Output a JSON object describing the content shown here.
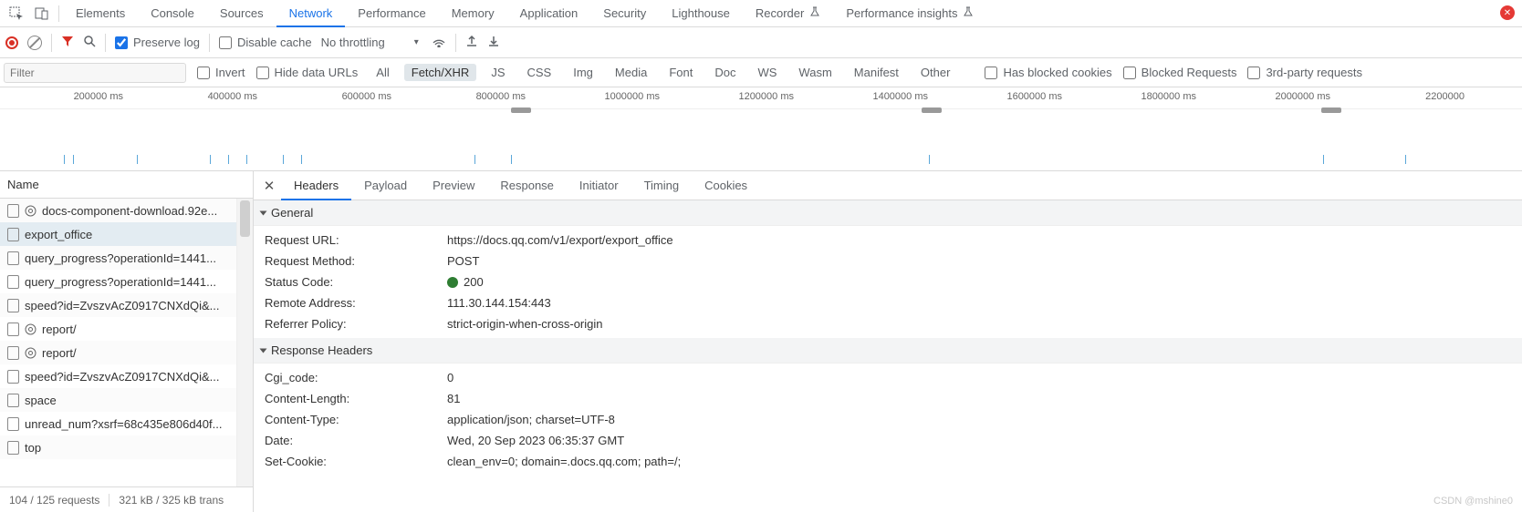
{
  "topTabs": [
    "Elements",
    "Console",
    "Sources",
    "Network",
    "Performance",
    "Memory",
    "Application",
    "Security",
    "Lighthouse",
    "Recorder",
    "Performance insights"
  ],
  "topActive": 3,
  "flaskTabs": [
    9,
    10
  ],
  "toolbar": {
    "preserveLog": "Preserve log",
    "disableCache": "Disable cache",
    "throttling": "No throttling"
  },
  "filter": {
    "placeholder": "Filter",
    "invert": "Invert",
    "hideData": "Hide data URLs",
    "types": [
      "All",
      "Fetch/XHR",
      "JS",
      "CSS",
      "Img",
      "Media",
      "Font",
      "Doc",
      "WS",
      "Wasm",
      "Manifest",
      "Other"
    ],
    "typeActive": 1,
    "hasBlocked": "Has blocked cookies",
    "blockedReq": "Blocked Requests",
    "thirdParty": "3rd-party requests"
  },
  "ticks": [
    "200000 ms",
    "400000 ms",
    "600000 ms",
    "800000 ms",
    "1000000 ms",
    "1200000 ms",
    "1400000 ms",
    "1600000 ms",
    "1800000 ms",
    "2000000 ms",
    "2200000"
  ],
  "nameHeader": "Name",
  "requests": [
    {
      "label": "docs-component-download.92e...",
      "type": "gear"
    },
    {
      "label": "export_office",
      "type": "doc",
      "selected": true
    },
    {
      "label": "query_progress?operationId=1441...",
      "type": "doc"
    },
    {
      "label": "query_progress?operationId=1441...",
      "type": "doc"
    },
    {
      "label": "speed?id=ZvszvAcZ0917CNXdQi&...",
      "type": "doc"
    },
    {
      "label": "report/",
      "type": "gear"
    },
    {
      "label": "report/",
      "type": "gear"
    },
    {
      "label": "speed?id=ZvszvAcZ0917CNXdQi&...",
      "type": "doc"
    },
    {
      "label": "space",
      "type": "doc"
    },
    {
      "label": "unread_num?xsrf=68c435e806d40f...",
      "type": "doc"
    },
    {
      "label": "top",
      "type": "doc"
    }
  ],
  "status": {
    "summary": "104 / 125 requests",
    "size": "321 kB / 325 kB trans"
  },
  "detailTabs": [
    "Headers",
    "Payload",
    "Preview",
    "Response",
    "Initiator",
    "Timing",
    "Cookies"
  ],
  "detailActive": 0,
  "sections": {
    "general": {
      "title": "General",
      "rows": [
        {
          "k": "Request URL:",
          "v": "https://docs.qq.com/v1/export/export_office"
        },
        {
          "k": "Request Method:",
          "v": "POST"
        },
        {
          "k": "Status Code:",
          "v": "200",
          "dot": true
        },
        {
          "k": "Remote Address:",
          "v": "111.30.144.154:443"
        },
        {
          "k": "Referrer Policy:",
          "v": "strict-origin-when-cross-origin"
        }
      ]
    },
    "responseHeaders": {
      "title": "Response Headers",
      "rows": [
        {
          "k": "Cgi_code:",
          "v": "0"
        },
        {
          "k": "Content-Length:",
          "v": "81"
        },
        {
          "k": "Content-Type:",
          "v": "application/json; charset=UTF-8"
        },
        {
          "k": "Date:",
          "v": "Wed, 20 Sep 2023 06:35:37 GMT"
        },
        {
          "k": "Set-Cookie:",
          "v": "clean_env=0; domain=.docs.qq.com; path=/;"
        }
      ]
    }
  },
  "watermark": "CSDN @mshine0"
}
